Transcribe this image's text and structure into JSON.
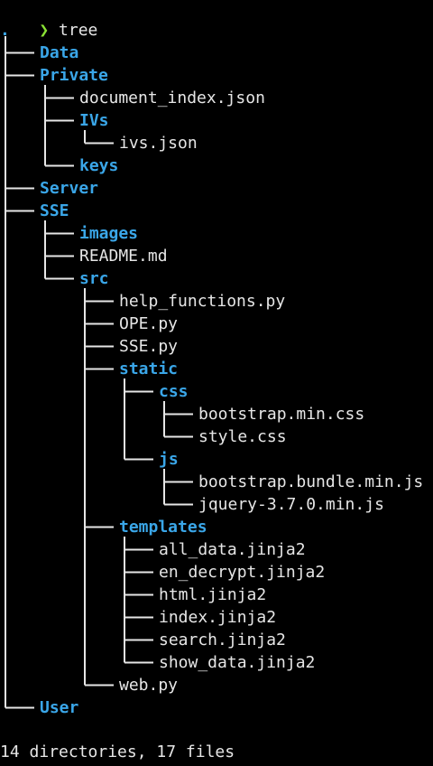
{
  "prompt": {
    "symbol": "❯",
    "command": "tree"
  },
  "root": ".",
  "entries": [
    {
      "name": "Data",
      "type": "dir",
      "depth": 1
    },
    {
      "name": "Private",
      "type": "dir",
      "depth": 1
    },
    {
      "name": "document_index.json",
      "type": "file",
      "depth": 2
    },
    {
      "name": "IVs",
      "type": "dir",
      "depth": 2
    },
    {
      "name": "ivs.json",
      "type": "file",
      "depth": 3
    },
    {
      "name": "keys",
      "type": "dir",
      "depth": 2
    },
    {
      "name": "Server",
      "type": "dir",
      "depth": 1
    },
    {
      "name": "SSE",
      "type": "dir",
      "depth": 1
    },
    {
      "name": "images",
      "type": "dir",
      "depth": 2
    },
    {
      "name": "README.md",
      "type": "file",
      "depth": 2
    },
    {
      "name": "src",
      "type": "dir",
      "depth": 2
    },
    {
      "name": "help_functions.py",
      "type": "file",
      "depth": 3
    },
    {
      "name": "OPE.py",
      "type": "file",
      "depth": 3
    },
    {
      "name": "SSE.py",
      "type": "file",
      "depth": 3
    },
    {
      "name": "static",
      "type": "dir",
      "depth": 3
    },
    {
      "name": "css",
      "type": "dir",
      "depth": 4
    },
    {
      "name": "bootstrap.min.css",
      "type": "file",
      "depth": 5
    },
    {
      "name": "style.css",
      "type": "file",
      "depth": 5
    },
    {
      "name": "js",
      "type": "dir",
      "depth": 4
    },
    {
      "name": "bootstrap.bundle.min.js",
      "type": "file",
      "depth": 5
    },
    {
      "name": "jquery-3.7.0.min.js",
      "type": "file",
      "depth": 5
    },
    {
      "name": "templates",
      "type": "dir",
      "depth": 3
    },
    {
      "name": "all_data.jinja2",
      "type": "file",
      "depth": 4
    },
    {
      "name": "en_decrypt.jinja2",
      "type": "file",
      "depth": 4
    },
    {
      "name": "html.jinja2",
      "type": "file",
      "depth": 4
    },
    {
      "name": "index.jinja2",
      "type": "file",
      "depth": 4
    },
    {
      "name": "search.jinja2",
      "type": "file",
      "depth": 4
    },
    {
      "name": "show_data.jinja2",
      "type": "file",
      "depth": 4
    },
    {
      "name": "web.py",
      "type": "file",
      "depth": 3
    },
    {
      "name": "User",
      "type": "dir",
      "depth": 1
    }
  ],
  "summary": "14 directories, 17 files",
  "colors": {
    "background": "#000000",
    "directory": "#3aa6e8",
    "file": "#e6e6e6",
    "prompt": "#8ae234",
    "tree_lines": "#e6e6e6"
  }
}
